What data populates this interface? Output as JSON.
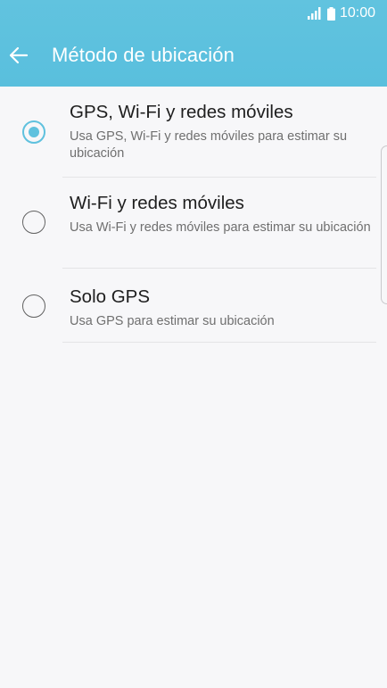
{
  "status_bar": {
    "time": "10:00",
    "signal_icon": "signal-icon",
    "battery_icon": "battery-icon"
  },
  "header": {
    "back_icon": "arrow-left-icon",
    "title": "Método de ubicación"
  },
  "options": [
    {
      "title": "GPS, Wi-Fi y redes móviles",
      "description": "Usa GPS, Wi-Fi y redes móviles para estimar su ubicación",
      "selected": true
    },
    {
      "title": "Wi-Fi y redes móviles",
      "description": "Usa Wi-Fi y redes móviles para estimar su ubicación",
      "selected": false
    },
    {
      "title": "Solo GPS",
      "description": "Usa GPS para estimar su ubicación",
      "selected": false
    }
  ],
  "colors": {
    "header_background": "#5fc1de",
    "accent": "#5fc1de",
    "screen_background": "#f7f7f9"
  }
}
